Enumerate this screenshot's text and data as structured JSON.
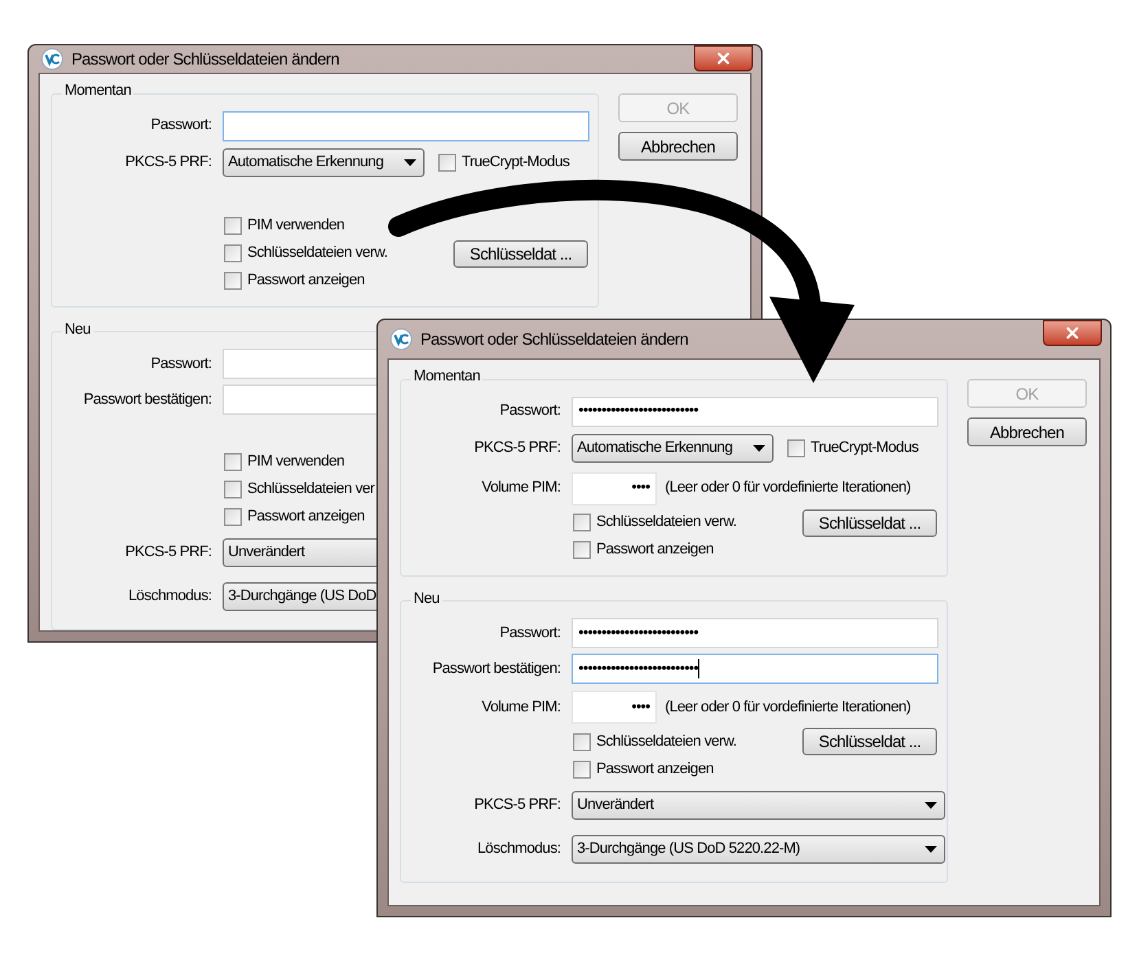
{
  "windows": [
    {
      "title": "Passwort oder Schlüsseldateien ändern",
      "buttons": [
        {
          "label": "OK",
          "disabled": true
        },
        {
          "label": "Abbrechen",
          "disabled": false
        }
      ],
      "sections": [
        {
          "legend": "Momentan",
          "rows": [
            {
              "kind": "field",
              "label": "Passwort:",
              "focused": true
            },
            {
              "kind": "select",
              "label": "PKCS-5 PRF:",
              "value": "Automatische Erkennung",
              "checkbox": {
                "label": "TrueCrypt-Modus",
                "checked": false
              }
            },
            {
              "kind": "gap"
            },
            {
              "kind": "check",
              "label": "PIM verwenden",
              "checked": false
            },
            {
              "kind": "check",
              "label": "Schlüsseldateien verw.",
              "checked": false,
              "button": "Schlüsseldat ..."
            },
            {
              "kind": "check",
              "label": "Passwort anzeigen",
              "checked": false
            }
          ]
        },
        {
          "legend": "Neu",
          "rows": [
            {
              "kind": "field",
              "label": "Passwort:",
              "focused": false
            },
            {
              "kind": "field",
              "label": "Passwort bestätigen:",
              "focused": false
            },
            {
              "kind": "gap"
            },
            {
              "kind": "check",
              "label": "PIM verwenden",
              "checked": false
            },
            {
              "kind": "check",
              "label": "Schlüsseldateien ver",
              "checked": false
            },
            {
              "kind": "check",
              "label": "Passwort anzeigen",
              "checked": false
            },
            {
              "kind": "select",
              "label": "PKCS-5 PRF:",
              "value": "Unverändert"
            },
            {
              "kind": "select",
              "label": "Löschmodus:",
              "value": "3-Durchgänge (US DoD"
            }
          ]
        }
      ]
    },
    {
      "title": "Passwort oder Schlüsseldateien ändern",
      "buttons": [
        {
          "label": "OK",
          "disabled": true
        },
        {
          "label": "Abbrechen",
          "disabled": false
        }
      ],
      "sections": [
        {
          "legend": "Momentan",
          "rows": [
            {
              "kind": "field",
              "label": "Passwort:",
              "value": "••••••••••••••••••••••••••",
              "focused": false
            },
            {
              "kind": "select",
              "label": "PKCS-5 PRF:",
              "value": "Automatische Erkennung",
              "checkbox": {
                "label": "TrueCrypt-Modus",
                "checked": false
              }
            },
            {
              "kind": "pim",
              "label": "Volume PIM:",
              "value": "••••",
              "hint": "(Leer oder 0 für vordefinierte Iterationen)"
            },
            {
              "kind": "check",
              "label": "Schlüsseldateien verw.",
              "checked": false,
              "button": "Schlüsseldat ..."
            },
            {
              "kind": "check",
              "label": "Passwort anzeigen",
              "checked": false
            }
          ]
        },
        {
          "legend": "Neu",
          "rows": [
            {
              "kind": "field",
              "label": "Passwort:",
              "value": "••••••••••••••••••••••••••",
              "focused": false
            },
            {
              "kind": "field",
              "label": "Passwort bestätigen:",
              "value": "••••••••••••••••••••••••••",
              "focused": true
            },
            {
              "kind": "pim",
              "label": "Volume PIM:",
              "value": "••••",
              "hint": "(Leer oder 0 für vordefinierte Iterationen)"
            },
            {
              "kind": "check",
              "label": "Schlüsseldateien verw.",
              "checked": false,
              "button": "Schlüsseldat ..."
            },
            {
              "kind": "check",
              "label": "Passwort anzeigen",
              "checked": false
            },
            {
              "kind": "select",
              "label": "PKCS-5 PRF:",
              "value": "Unverändert"
            },
            {
              "kind": "select",
              "label": "Löschmodus:",
              "value": "3-Durchgänge (US DoD 5220.22-M)"
            }
          ]
        }
      ]
    }
  ]
}
